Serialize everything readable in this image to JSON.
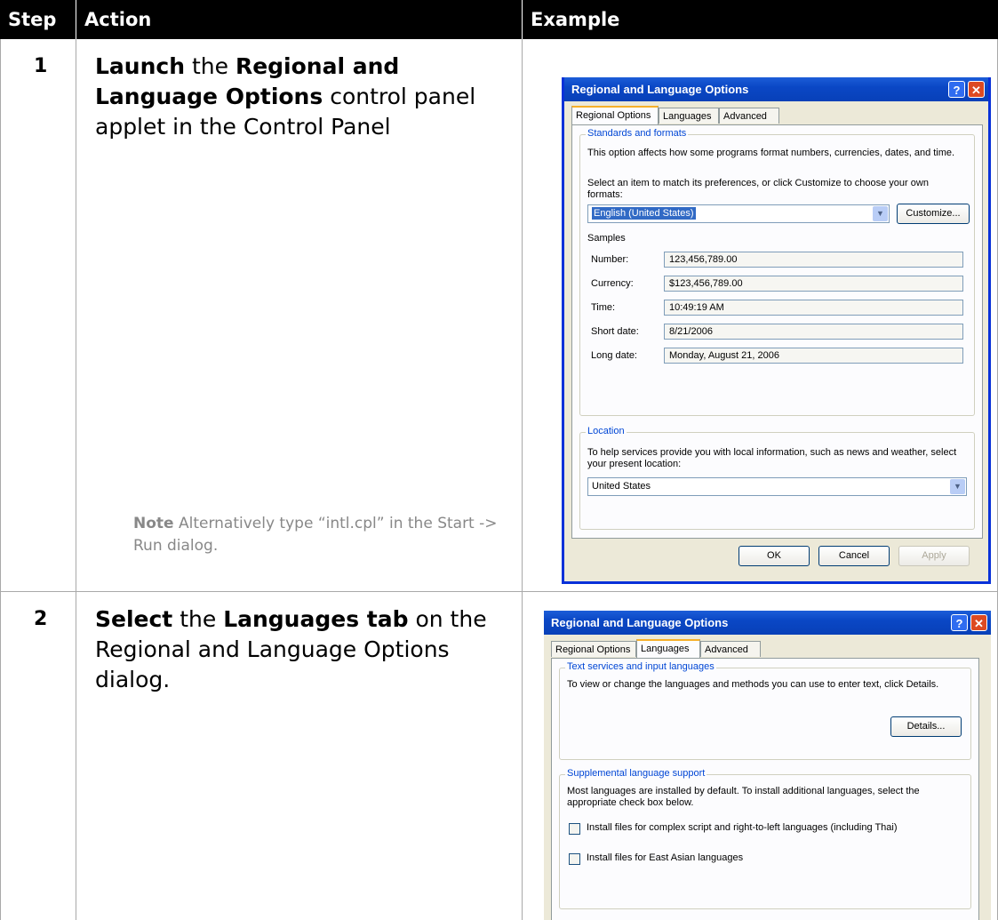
{
  "table": {
    "headers": {
      "step": "Step",
      "action": "Action",
      "example": "Example"
    },
    "rows": [
      {
        "step": "1",
        "action": [
          {
            "text": "Launch",
            "bold": true
          },
          {
            "text": " the ",
            "bold": false
          },
          {
            "text": "Regional and Language Options",
            "bold": true
          },
          {
            "text": " control panel applet in the Control Panel",
            "bold": false
          }
        ],
        "note": {
          "label": "Note",
          "text": "  Alternatively type “intl.cpl” in the Start -> Run dialog."
        }
      },
      {
        "step": "2",
        "action": [
          {
            "text": "Select",
            "bold": true
          },
          {
            "text": " the ",
            "bold": false
          },
          {
            "text": "Languages tab",
            "bold": true
          },
          {
            "text": " on the Regional and Language Options dialog.",
            "bold": false
          }
        ]
      }
    ]
  },
  "dialog1": {
    "title": "Regional and Language Options",
    "help_button": "?",
    "close_button": "✕",
    "tabs": [
      "Regional Options",
      "Languages",
      "Advanced"
    ],
    "standards_group": "Standards and formats",
    "standards_desc": "This option affects how some programs format numbers, currencies, dates, and time.",
    "select_desc": "Select an item to match its preferences, or click Customize to choose your own formats:",
    "format_value": "English (United States)",
    "customize_button": "Customize...",
    "samples_label": "Samples",
    "samples": [
      {
        "label": "Number:",
        "value": "123,456,789.00"
      },
      {
        "label": "Currency:",
        "value": "$123,456,789.00"
      },
      {
        "label": "Time:",
        "value": "10:49:19 AM"
      },
      {
        "label": "Short date:",
        "value": "8/21/2006"
      },
      {
        "label": "Long date:",
        "value": "Monday, August 21, 2006"
      }
    ],
    "location_group": "Location",
    "location_desc": "To help services provide you with local information, such as news and weather, select your present location:",
    "location_value": "United States",
    "ok_button": "OK",
    "cancel_button": "Cancel",
    "apply_button": "Apply"
  },
  "dialog2": {
    "title": "Regional and Language Options",
    "help_button": "?",
    "close_button": "✕",
    "tabs": [
      "Regional Options",
      "Languages",
      "Advanced"
    ],
    "text_services_group": "Text services and input languages",
    "text_services_desc": "To view or change the languages and methods you can use to enter text, click Details.",
    "details_button": "Details...",
    "supplemental_group": "Supplemental language support",
    "supplemental_desc": "Most languages are installed by default. To install additional languages, select the appropriate check box below.",
    "checkbox1": "Install files for complex script and right-to-left languages (including Thai)",
    "checkbox2": "Install files for East Asian languages"
  }
}
